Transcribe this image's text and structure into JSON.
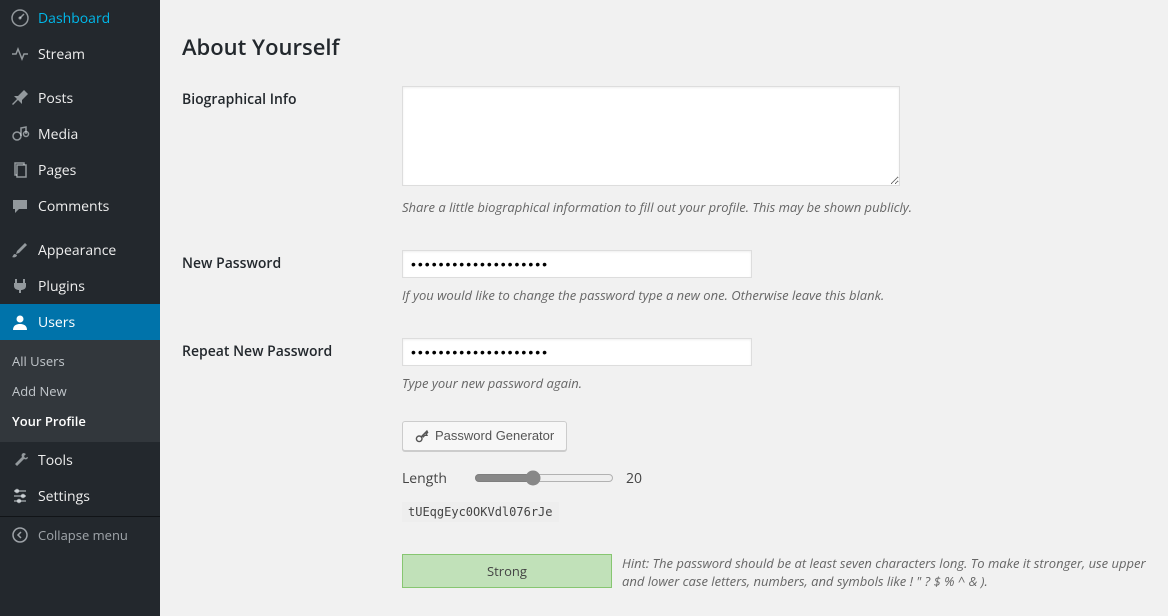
{
  "sidebar": {
    "items": [
      {
        "label": "Dashboard",
        "icon": "dashboard"
      },
      {
        "label": "Stream",
        "icon": "stream"
      },
      {
        "label": "Posts",
        "icon": "pin"
      },
      {
        "label": "Media",
        "icon": "media"
      },
      {
        "label": "Pages",
        "icon": "pages"
      },
      {
        "label": "Comments",
        "icon": "comment"
      },
      {
        "label": "Appearance",
        "icon": "brush"
      },
      {
        "label": "Plugins",
        "icon": "plug"
      },
      {
        "label": "Users",
        "icon": "user",
        "current": true
      },
      {
        "label": "Tools",
        "icon": "wrench"
      },
      {
        "label": "Settings",
        "icon": "sliders"
      }
    ],
    "submenu": {
      "all": "All Users",
      "add": "Add New",
      "profile": "Your Profile"
    },
    "collapse": "Collapse menu"
  },
  "heading": "About Yourself",
  "bio": {
    "label": "Biographical Info",
    "value": "",
    "description": "Share a little biographical information to fill out your profile. This may be shown publicly."
  },
  "password": {
    "new_label": "New Password",
    "new_value": "••••••••••••••••••••",
    "new_description": "If you would like to change the password type a new one. Otherwise leave this blank.",
    "repeat_label": "Repeat New Password",
    "repeat_value": "••••••••••••••••••••",
    "repeat_description": "Type your new password again.",
    "generator_button": "Password Generator",
    "length_label": "Length",
    "length_value": "20",
    "generated": "tUEqgEyc0OKVdl076rJe",
    "strength_label": "Strong",
    "hint": "Hint: The password should be at least seven characters long. To make it stronger, use upper and lower case letters, numbers, and symbols like ! \" ? $ % ^ & )."
  }
}
